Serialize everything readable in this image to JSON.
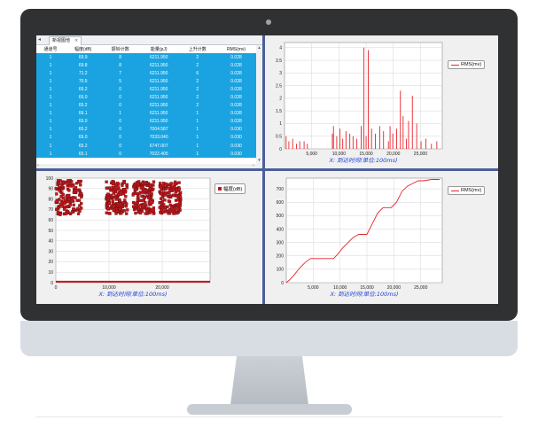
{
  "tab": {
    "arrow": "◂",
    "label": "新视图他",
    "close": "×"
  },
  "table": {
    "headers": [
      "通道号",
      "幅度(dB)",
      "振铃计数",
      "能量(pJ)",
      "上升计数",
      "RMS(mv)"
    ],
    "rows": [
      [
        "1",
        "69.9",
        "8",
        "6211.950",
        "2",
        "0.028"
      ],
      [
        "1",
        "69.8",
        "8",
        "6211.950",
        "2",
        "0.028"
      ],
      [
        "1",
        "71.2",
        "7",
        "6211.950",
        "6",
        "0.028"
      ],
      [
        "1",
        "70.5",
        "5",
        "6211.950",
        "2",
        "0.028"
      ],
      [
        "1",
        "65.2",
        "0",
        "6211.950",
        "2",
        "0.028"
      ],
      [
        "1",
        "65.0",
        "0",
        "6211.950",
        "2",
        "0.028"
      ],
      [
        "1",
        "65.2",
        "0",
        "6211.950",
        "2",
        "0.028"
      ],
      [
        "1",
        "66.1",
        "1",
        "6211.950",
        "1",
        "0.028"
      ],
      [
        "1",
        "65.0",
        "0",
        "6211.950",
        "1",
        "0.028"
      ],
      [
        "1",
        "65.2",
        "0",
        "7004.587",
        "1",
        "0.030"
      ],
      [
        "1",
        "65.0",
        "0",
        "7033.040",
        "1",
        "0.030"
      ],
      [
        "1",
        "65.2",
        "0",
        "6747.007",
        "1",
        "0.030"
      ],
      [
        "1",
        "65.1",
        "0",
        "7022.405",
        "1",
        "0.030"
      ]
    ]
  },
  "scroll": {
    "up": "▴",
    "down": "▾",
    "left": "‹",
    "right": "›"
  },
  "colors": {
    "table_row": "#1aa3e0",
    "series": "#e8232a",
    "scatter": "#c0171c",
    "divider": "#4b5f9a"
  },
  "chart_data": [
    {
      "type": "bar",
      "xlabel": "X: 到达时间(单位:100ms)",
      "ylabel": "",
      "xlim": [
        0,
        29000
      ],
      "ylim": [
        0,
        4.2
      ],
      "x_ticks": [
        "5,000",
        "10,000",
        "15,000",
        "20,000",
        "25,000"
      ],
      "y_ticks": [
        "0",
        "0.5",
        "1",
        "1.5",
        "2",
        "2.5",
        "3",
        "3.5",
        "4"
      ],
      "legend": [
        "RMS(mv)"
      ],
      "legend_position": "right",
      "series": [
        {
          "name": "RMS(mv)",
          "x": [
            300,
            800,
            1500,
            2200,
            2800,
            3600,
            4200,
            8800,
            9000,
            9600,
            10200,
            10700,
            11300,
            12000,
            12600,
            13300,
            14100,
            14600,
            15000,
            15400,
            16000,
            16700,
            17500,
            18200,
            19100,
            19400,
            19900,
            20600,
            21300,
            21800,
            22400,
            22800,
            23500,
            24300,
            25100,
            26000,
            27000,
            28000
          ],
          "values": [
            0.5,
            0.3,
            0.4,
            0.2,
            0.3,
            0.3,
            0.2,
            0.6,
            0.9,
            0.5,
            0.8,
            0.4,
            0.7,
            0.6,
            0.5,
            0.4,
            0.9,
            4.0,
            0.5,
            3.9,
            0.8,
            0.6,
            0.9,
            0.7,
            0.3,
            0.9,
            0.6,
            0.8,
            2.3,
            1.3,
            0.4,
            1.1,
            2.1,
            1.0,
            0.3,
            0.4,
            0.2,
            0.3
          ]
        }
      ]
    },
    {
      "type": "scatter",
      "xlabel": "X: 到达时间(单位:100ms)",
      "ylabel": "",
      "xlim": [
        0,
        29000
      ],
      "ylim": [
        0,
        100
      ],
      "x_ticks": [
        "0",
        "10,000",
        "20,000"
      ],
      "y_ticks": [
        "0",
        "10",
        "20",
        "30",
        "40",
        "50",
        "60",
        "70",
        "80",
        "90",
        "100"
      ],
      "legend": [
        "幅度(dB)"
      ],
      "legend_position": "right",
      "clusters": [
        {
          "x_range": [
            0,
            5000
          ],
          "y_range": [
            65,
            98
          ]
        },
        {
          "x_range": [
            9500,
            13500
          ],
          "y_range": [
            66,
            97
          ]
        },
        {
          "x_range": [
            14500,
            18500
          ],
          "y_range": [
            66,
            97
          ]
        },
        {
          "x_range": [
            19500,
            23500
          ],
          "y_range": [
            66,
            97
          ]
        }
      ],
      "baseline_y": 1
    },
    {
      "type": "line",
      "xlabel": "X: 到达时间(单位:100ms)",
      "ylabel": "",
      "xlim": [
        0,
        29000
      ],
      "ylim": [
        0,
        780
      ],
      "x_ticks": [
        "5,000",
        "10,000",
        "15,000",
        "20,000",
        "25,000"
      ],
      "y_ticks": [
        "0",
        "100",
        "200",
        "300",
        "400",
        "500",
        "600",
        "700"
      ],
      "legend": [
        "RMS(mv)"
      ],
      "legend_position": "right",
      "series": [
        {
          "name": "RMS(mv)",
          "x": [
            0,
            600,
            1500,
            2500,
            3500,
            4500,
            5000,
            8800,
            9500,
            10500,
            11500,
            12500,
            13500,
            14500,
            15000,
            16000,
            17000,
            18000,
            19000,
            19500,
            20500,
            21500,
            22500,
            23500,
            24500,
            25500,
            27000,
            28500
          ],
          "values": [
            0,
            20,
            60,
            110,
            150,
            180,
            180,
            180,
            210,
            260,
            300,
            340,
            360,
            360,
            360,
            440,
            520,
            560,
            560,
            560,
            600,
            680,
            720,
            740,
            760,
            760,
            770,
            770
          ]
        }
      ]
    }
  ]
}
